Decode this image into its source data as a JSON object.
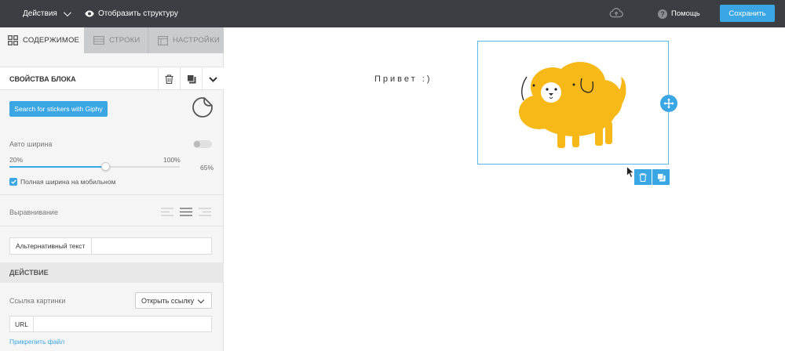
{
  "topbar": {
    "actions_label": "Действия",
    "structure_label": "Отобразить структуру",
    "help_label": "Помощь",
    "save_label": "Сохранить"
  },
  "tabs": [
    {
      "label": "СОДЕРЖИМОЕ",
      "active": true
    },
    {
      "label": "СТРОКИ",
      "active": false
    },
    {
      "label": "НАСТРОЙКИ",
      "active": false
    }
  ],
  "block_properties": {
    "title": "СВОЙСТВА БЛОКА",
    "giphy_button": "Search for stickers with Giphy",
    "auto_width_label": "Авто ширина",
    "auto_width_on": false,
    "slider": {
      "min_label": "20%",
      "max_label": "100%",
      "value_label": "65%",
      "min": 20,
      "max": 100,
      "value": 65
    },
    "full_width_mobile_label": "Полная ширина на мобильном",
    "full_width_mobile_checked": true,
    "alignment_label": "Выравнивание",
    "alignment_selected": "center",
    "alt_text_label": "Альтернативный текст",
    "alt_text_value": ""
  },
  "action_section": {
    "title": "ДЕЙСТВИЕ",
    "link_label": "Ссылка картинки",
    "link_select_value": "Открыть ссылку",
    "url_label": "URL",
    "url_value": "",
    "attach_label": "Прикрепить файл"
  },
  "canvas": {
    "greeting_text": "Привет :)"
  },
  "colors": {
    "topbar_bg": "#3b3e43",
    "accent": "#3aa6e4",
    "dog_yellow": "#f7b918"
  }
}
